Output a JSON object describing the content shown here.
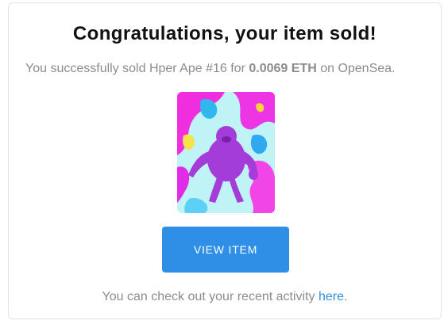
{
  "email": {
    "title": "Congratulations, your item sold!",
    "subtitle": {
      "prefix": "You successfully sold Hper Ape #16 for ",
      "price": "0.0069 ETH",
      "suffix": " on OpenSea."
    },
    "image": {
      "icon": "ape-nft-image"
    },
    "button_label": "VIEW ITEM",
    "footer": {
      "text": "You can check out your recent activity ",
      "link_label": "here",
      "period": "."
    }
  },
  "colors": {
    "accent": "#2f8ee6",
    "muted_text": "#8c8c8c",
    "title_text": "#111111"
  }
}
